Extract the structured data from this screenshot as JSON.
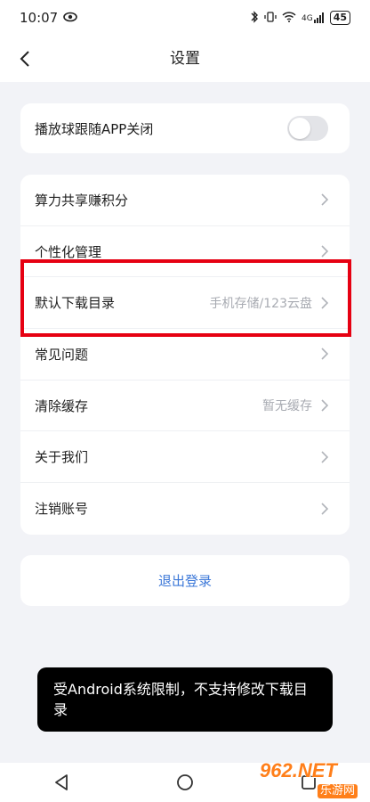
{
  "status_bar": {
    "time": "10:07",
    "signal": "4G",
    "battery": "45"
  },
  "header": {
    "title": "设置"
  },
  "toggle_row": {
    "label": "播放球跟随APP关闭",
    "enabled": false
  },
  "settings": [
    {
      "label": "算力共享赚积分",
      "value": ""
    },
    {
      "label": "个性化管理",
      "value": ""
    },
    {
      "label": "默认下载目录",
      "value": "手机存储/123云盘"
    },
    {
      "label": "常见问题",
      "value": ""
    },
    {
      "label": "清除缓存",
      "value": "暂无缓存"
    },
    {
      "label": "关于我们",
      "value": ""
    },
    {
      "label": "注销账号",
      "value": ""
    }
  ],
  "logout": {
    "label": "退出登录"
  },
  "toast": {
    "message": "受Android系统限制，不支持修改下载目录"
  },
  "watermark": {
    "brand": "962.NET",
    "sub": "乐游网"
  },
  "colors": {
    "highlight": "#e60012",
    "link": "#3c78d8",
    "background": "#f2f3f7"
  }
}
